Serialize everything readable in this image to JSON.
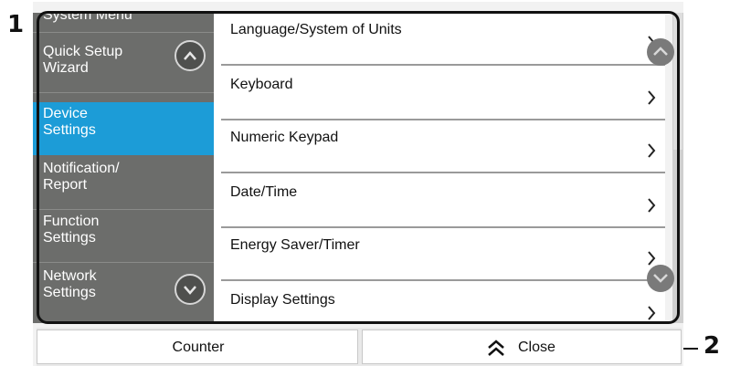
{
  "callouts": {
    "one": "1",
    "two": "2"
  },
  "sidebar": {
    "header": "System Menu",
    "items": [
      {
        "line1": "Quick Setup",
        "line2": "Wizard",
        "active": false
      },
      {
        "line1": "Device",
        "line2": "Settings",
        "active": true
      },
      {
        "line1": "Notification/",
        "line2": "Report",
        "active": false
      },
      {
        "line1": "Function",
        "line2": "Settings",
        "active": false
      },
      {
        "line1": "Network",
        "line2": "Settings",
        "active": false
      }
    ],
    "scroll_up_icon": "chevron-up-icon",
    "scroll_down_icon": "chevron-down-icon"
  },
  "main": {
    "items": [
      {
        "label": "Language/System of Units"
      },
      {
        "label": "Keyboard"
      },
      {
        "label": "Numeric Keypad"
      },
      {
        "label": "Date/Time"
      },
      {
        "label": "Energy Saver/Timer"
      },
      {
        "label": "Display Settings"
      }
    ],
    "row_icon": "chevron-right-icon"
  },
  "bottom": {
    "counter_label": "Counter",
    "close_label": "Close",
    "close_icon": "double-chevron-up-icon"
  },
  "colors": {
    "sidebar_bg": "#6c6d6b",
    "active_bg": "#1c9cd7",
    "text_light": "#ffffff",
    "text_dark": "#111111"
  }
}
